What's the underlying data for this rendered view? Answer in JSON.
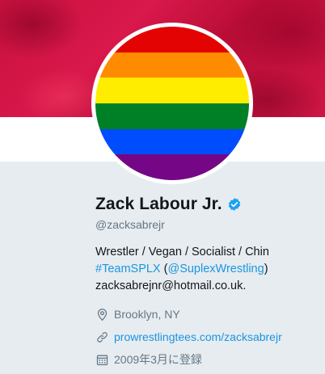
{
  "profile": {
    "name": "Zack Labour Jr.",
    "handle": "@zacksabrejr",
    "bio": {
      "line1": "Wrestler / Vegan / Socialist / Chin",
      "hashtag": "#TeamSPLX",
      "open_paren": " (",
      "mention": "@SuplexWrestling",
      "close_paren": ")",
      "email": "zacksabrejnr@hotmail.co.uk."
    },
    "location": "Brooklyn, NY",
    "website": "prowrestlingtees.com/zacksabrejr",
    "joined": "2009年3月に登録"
  },
  "avatar": {
    "stripes": [
      "#e40303",
      "#ff8c00",
      "#ffed00",
      "#008026",
      "#004dff",
      "#750787"
    ]
  },
  "icons": {
    "verified": "verified-badge-icon",
    "location": "location-pin-icon",
    "website": "link-icon",
    "joined": "calendar-icon"
  },
  "colors": {
    "accent": "#1b95e0",
    "banner": "#c8113e",
    "verified": "#1da1f2",
    "muted": "#657786"
  }
}
